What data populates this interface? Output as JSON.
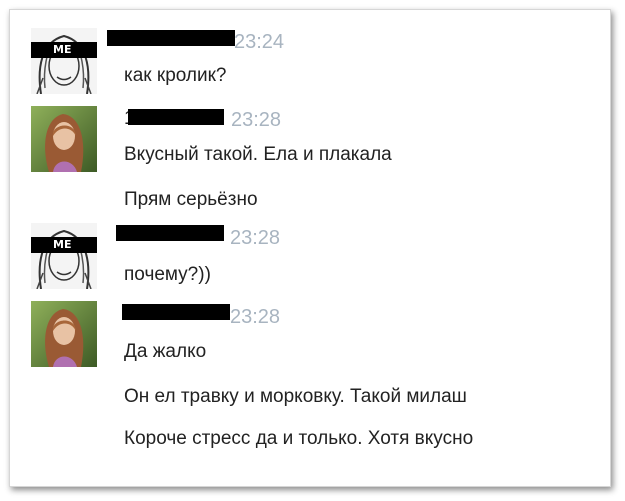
{
  "conversation": {
    "blocks": [
      {
        "sender": "me",
        "time": "23:24",
        "avatar_icon": "me-sketch-avatar",
        "messages": [
          "как кролик?"
        ]
      },
      {
        "sender": "girl",
        "time": "23:28",
        "name_fragment": "1",
        "avatar_icon": "girl-photo-avatar",
        "messages": [
          "Вкусный такой. Ела и плакала",
          "Прям серьёзно"
        ]
      },
      {
        "sender": "me",
        "time": "23:28",
        "avatar_icon": "me-sketch-avatar",
        "messages": [
          "почему?))"
        ]
      },
      {
        "sender": "girl",
        "time": "23:28",
        "avatar_icon": "girl-photo-avatar",
        "messages": [
          "Да жалко",
          "Он ел травку и морковку. Такой милаш",
          "Короче стресс да и только. Хотя вкусно"
        ]
      }
    ],
    "me_avatar_label": "ME"
  },
  "colors": {
    "time_text": "#a8b4c0",
    "message_text": "#222222",
    "redaction": "#000000"
  }
}
